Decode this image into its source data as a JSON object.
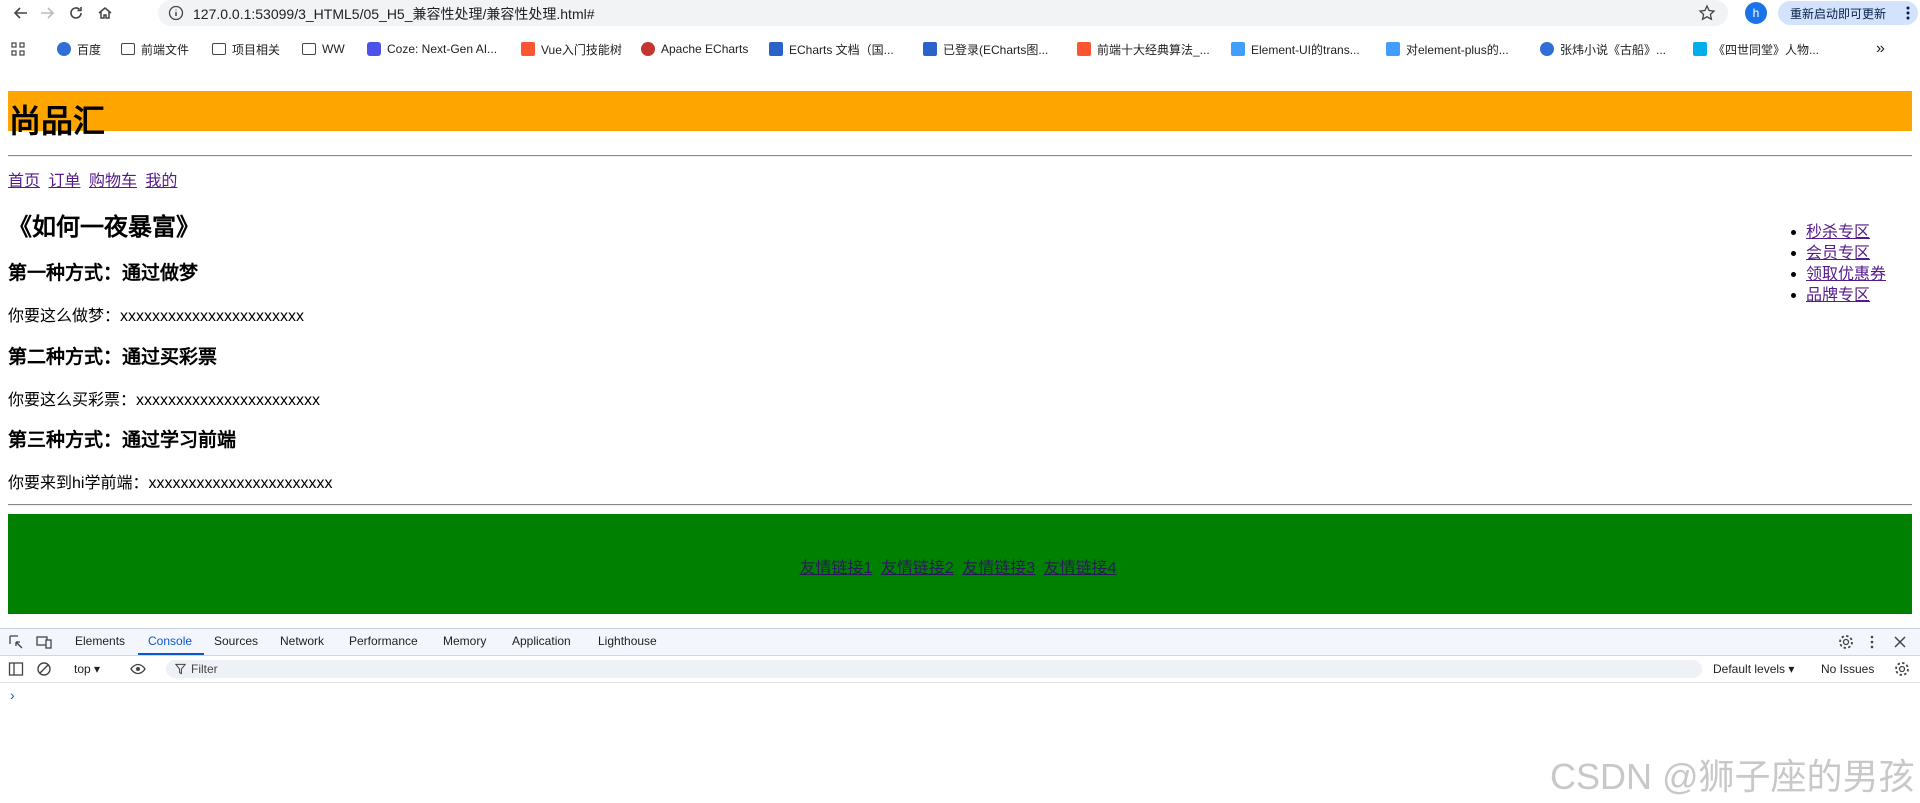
{
  "browser": {
    "url": "127.0.0.1:53099/3_HTML5/05_H5_兼容性处理/兼容性处理.html#",
    "profile_initial": "h",
    "relaunch_label": "重新启动即可更新"
  },
  "bookmarks": [
    {
      "label": "百度",
      "icon": "baidu-paw-icon"
    },
    {
      "label": "前端文件",
      "icon": "folder-icon"
    },
    {
      "label": "项目相关",
      "icon": "folder-icon"
    },
    {
      "label": "WW",
      "icon": "folder-icon"
    },
    {
      "label": "Coze: Next-Gen AI...",
      "icon": "coze-icon"
    },
    {
      "label": "Vue入门技能树",
      "icon": "csdn-icon"
    },
    {
      "label": "Apache ECharts",
      "icon": "echarts-icon"
    },
    {
      "label": "ECharts 文档（国...",
      "icon": "chart-icon"
    },
    {
      "label": "已登录(ECharts图...",
      "icon": "chart-icon"
    },
    {
      "label": "前端十大经典算法_...",
      "icon": "csdn-icon"
    },
    {
      "label": "Element-UI的trans...",
      "icon": "element-icon"
    },
    {
      "label": "对element-plus的...",
      "icon": "element-icon"
    },
    {
      "label": "张炜小说《古船》...",
      "icon": "baidu-paw-icon"
    },
    {
      "label": "《四世同堂》人物...",
      "icon": "bilibili-icon"
    }
  ],
  "page": {
    "site_title": "尚品汇",
    "nav": [
      "首页",
      "订单",
      "购物车",
      "我的"
    ],
    "article_title": "《如何一夜暴富》",
    "sections": [
      {
        "heading": "第一种方式：通过做梦",
        "text": "你要这么做梦：xxxxxxxxxxxxxxxxxxxxxxx"
      },
      {
        "heading": "第二种方式：通过买彩票",
        "text": "你要这么买彩票：xxxxxxxxxxxxxxxxxxxxxxx"
      },
      {
        "heading": "第三种方式：通过学习前端",
        "text": "你要来到hi学前端：xxxxxxxxxxxxxxxxxxxxxxx"
      }
    ],
    "aside": [
      "秒杀专区",
      "会员专区",
      "领取优惠券",
      "品牌专区"
    ],
    "footer_links": [
      "友情链接1",
      "友情链接2",
      "友情链接3",
      "友情链接4"
    ],
    "colors": {
      "header": "#ffa500",
      "footer": "#008000"
    }
  },
  "devtools": {
    "tabs": [
      "Elements",
      "Console",
      "Sources",
      "Network",
      "Performance",
      "Memory",
      "Application",
      "Lighthouse"
    ],
    "active_tab": "Console",
    "context": "top",
    "filter_placeholder": "Filter",
    "levels": "Default levels",
    "issues": "No Issues",
    "prompt": "›"
  },
  "watermark": "CSDN @狮子座的男孩"
}
